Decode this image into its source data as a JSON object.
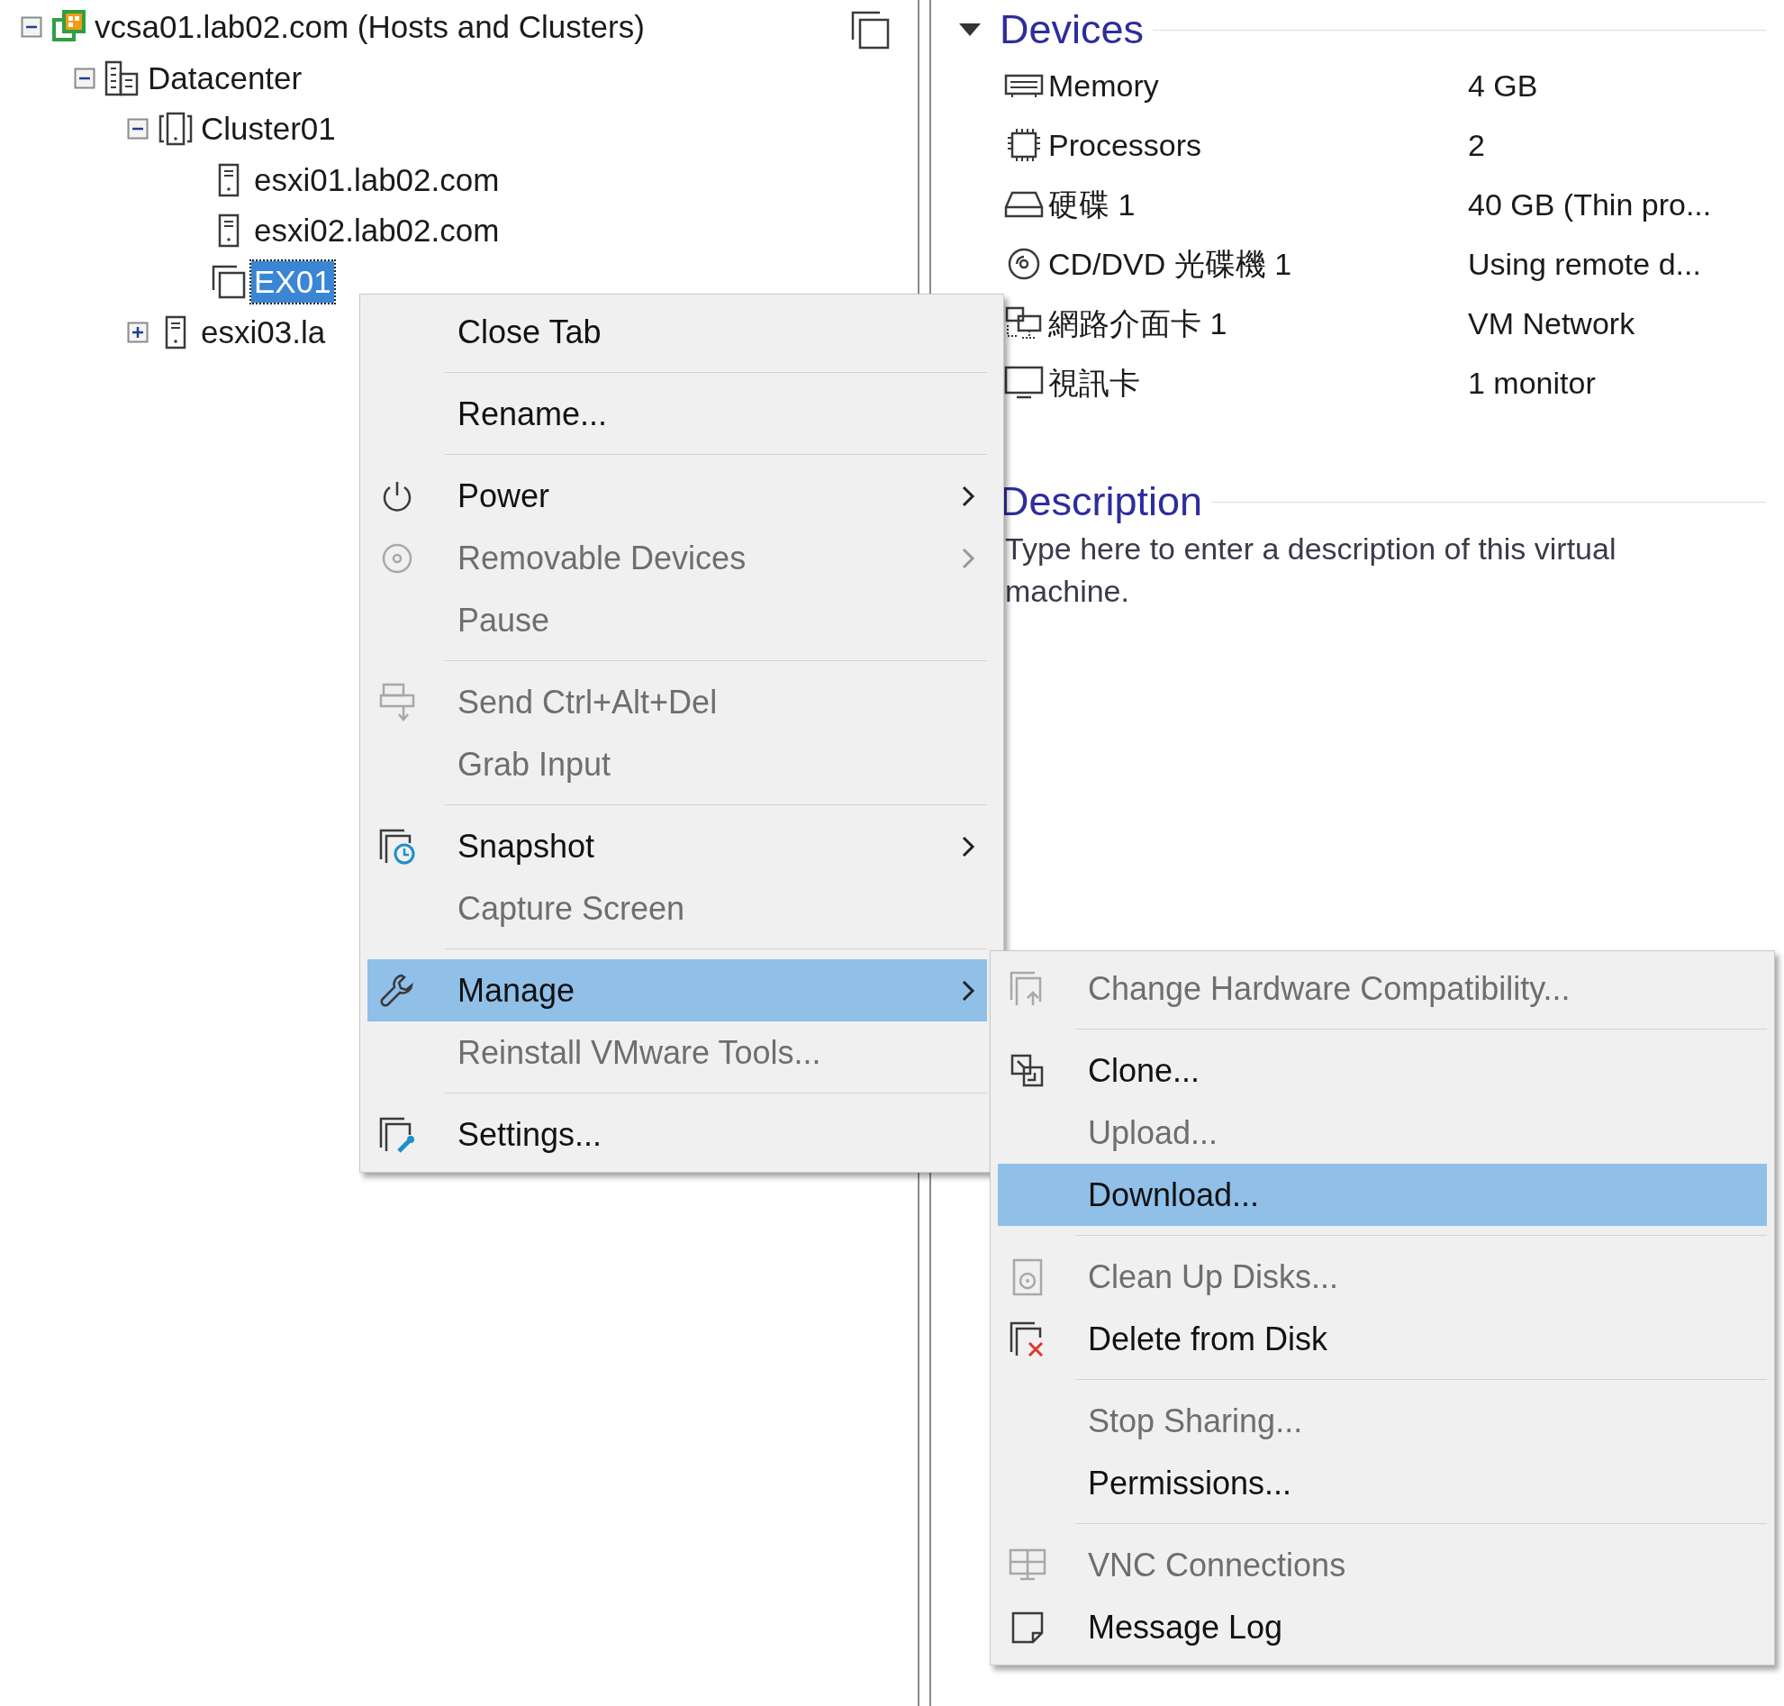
{
  "tree": {
    "items": [
      {
        "label": "vcsa01.lab02.com (Hosts and Clusters)",
        "kind": "vcenter",
        "expanded": true,
        "selected": false,
        "children": [
          {
            "label": "Datacenter",
            "kind": "datacenter",
            "expanded": true,
            "selected": false,
            "children": [
              {
                "label": "Cluster01",
                "kind": "cluster",
                "expanded": true,
                "selected": false,
                "children": [
                  {
                    "label": "esxi01.lab02.com",
                    "kind": "host",
                    "selected": false
                  },
                  {
                    "label": "esxi02.lab02.com",
                    "kind": "host",
                    "selected": false
                  },
                  {
                    "label": "EX01",
                    "kind": "vm",
                    "selected": true
                  }
                ]
              },
              {
                "label": "esxi03.la",
                "kind": "host",
                "expanded": false,
                "selected": false
              }
            ]
          }
        ]
      }
    ]
  },
  "context_menu": {
    "groups": [
      {
        "items": [
          {
            "label": "Close Tab",
            "disabled": false,
            "has_submenu": false,
            "selected": false
          }
        ]
      },
      {
        "items": [
          {
            "label": "Rename...",
            "disabled": false,
            "has_submenu": false,
            "selected": false
          }
        ]
      },
      {
        "items": [
          {
            "label": "Power",
            "disabled": false,
            "has_submenu": true,
            "selected": false
          },
          {
            "label": "Removable Devices",
            "disabled": true,
            "has_submenu": true,
            "selected": false
          },
          {
            "label": "Pause",
            "disabled": true,
            "has_submenu": false,
            "selected": false
          }
        ]
      },
      {
        "items": [
          {
            "label": "Send Ctrl+Alt+Del",
            "disabled": true,
            "has_submenu": false,
            "selected": false
          },
          {
            "label": "Grab Input",
            "disabled": true,
            "has_submenu": false,
            "selected": false
          }
        ]
      },
      {
        "items": [
          {
            "label": "Snapshot",
            "disabled": false,
            "has_submenu": true,
            "selected": false
          },
          {
            "label": "Capture Screen",
            "disabled": true,
            "has_submenu": false,
            "selected": false
          }
        ]
      },
      {
        "items": [
          {
            "label": "Manage",
            "disabled": false,
            "has_submenu": true,
            "selected": true
          },
          {
            "label": "Reinstall VMware Tools...",
            "disabled": true,
            "has_submenu": false,
            "selected": false
          }
        ]
      },
      {
        "items": [
          {
            "label": "Settings...",
            "disabled": false,
            "has_submenu": false,
            "selected": false
          }
        ]
      }
    ]
  },
  "submenu": {
    "groups": [
      {
        "items": [
          {
            "label": "Change Hardware Compatibility...",
            "disabled": true,
            "selected": false
          }
        ]
      },
      {
        "items": [
          {
            "label": "Clone...",
            "disabled": false,
            "selected": false
          },
          {
            "label": "Upload...",
            "disabled": true,
            "selected": false
          },
          {
            "label": "Download...",
            "disabled": false,
            "selected": true
          }
        ]
      },
      {
        "items": [
          {
            "label": "Clean Up Disks...",
            "disabled": true,
            "selected": false
          },
          {
            "label": "Delete from Disk",
            "disabled": false,
            "selected": false
          }
        ]
      },
      {
        "items": [
          {
            "label": "Stop Sharing...",
            "disabled": true,
            "selected": false
          },
          {
            "label": "Permissions...",
            "disabled": false,
            "selected": false
          }
        ]
      },
      {
        "items": [
          {
            "label": "VNC Connections",
            "disabled": true,
            "selected": false
          },
          {
            "label": "Message Log",
            "disabled": false,
            "selected": false
          }
        ]
      }
    ]
  },
  "devices": {
    "title": "Devices",
    "expanded": true,
    "rows": [
      {
        "label": "Memory",
        "value": "4 GB"
      },
      {
        "label": "Processors",
        "value": "2"
      },
      {
        "label": "硬碟 1",
        "value": "40 GB (Thin pro..."
      },
      {
        "label": "CD/DVD 光碟機 1",
        "value": "Using remote d..."
      },
      {
        "label": "網路介面卡 1",
        "value": "VM Network"
      },
      {
        "label": "視訊卡",
        "value": "1 monitor"
      }
    ]
  },
  "description": {
    "title": "Description",
    "text": "Type here to enter a description of this virtual machine."
  }
}
